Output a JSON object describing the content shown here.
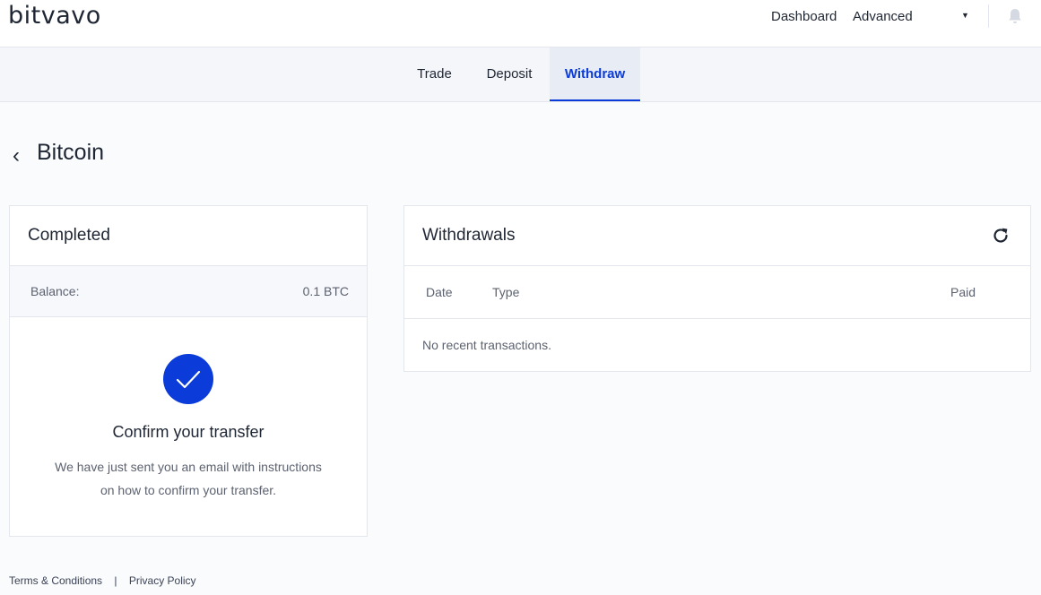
{
  "header": {
    "logo": "bitvavo",
    "nav": {
      "dashboard": "Dashboard",
      "advanced": "Advanced"
    }
  },
  "tabs": {
    "trade": "Trade",
    "deposit": "Deposit",
    "withdraw": "Withdraw",
    "active": "Withdraw"
  },
  "page": {
    "title": "Bitcoin"
  },
  "status_card": {
    "title": "Completed",
    "balance_label": "Balance:",
    "balance_value": "0.1 BTC",
    "confirm_title": "Confirm your transfer",
    "confirm_line1": "We have just sent you an email with instructions",
    "confirm_line2": "on how to confirm your transfer."
  },
  "withdrawals_card": {
    "title": "Withdrawals",
    "columns": [
      "Date",
      "Type",
      "Paid"
    ],
    "empty_message": "No recent transactions."
  },
  "footer": {
    "terms": "Terms & Conditions",
    "separator": "|",
    "privacy": "Privacy Policy"
  },
  "colors": {
    "accent": "#0b3bd9",
    "text": "#1f2633",
    "muted": "#5c6270",
    "border": "#e3e6ec"
  },
  "icons": {
    "back": "chevron-left-icon",
    "dropdown": "caret-down-icon",
    "notifications": "bell-icon",
    "success": "check-icon",
    "refresh": "refresh-icon"
  }
}
